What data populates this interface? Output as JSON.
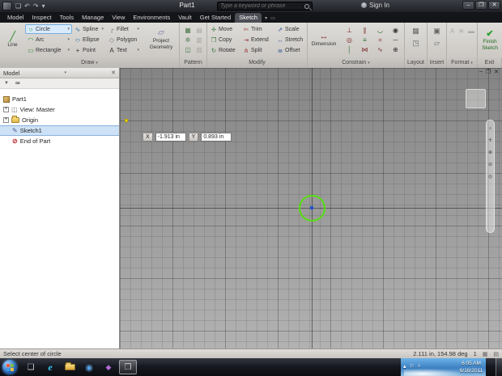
{
  "ui": {
    "dropdown": "▾"
  },
  "titlebar": {
    "qat_icons": [
      "❏",
      "↶",
      "↷",
      "▾"
    ],
    "title": "Part1",
    "search_placeholder": "Type a keyword or phrase",
    "sign_in": "Sign In",
    "minimize": "–",
    "maximize": "❐",
    "close": "✕"
  },
  "tabs": [
    {
      "label": "Model"
    },
    {
      "label": "Inspect"
    },
    {
      "label": "Tools"
    },
    {
      "label": "Manage"
    },
    {
      "label": "View"
    },
    {
      "label": "Environments"
    },
    {
      "label": "Vault"
    },
    {
      "label": "Get Started"
    },
    {
      "label": "Sketch"
    }
  ],
  "tab_extras": {
    "arrow": "▾",
    "panel_toggle": "▭"
  },
  "ribbon": {
    "draw": {
      "label": "Draw",
      "line": {
        "glyph": "╱",
        "label": "Line"
      },
      "tools": [
        {
          "glyph": "○",
          "label": "Circle"
        },
        {
          "glyph": "∿",
          "label": "Spline"
        },
        {
          "glyph": "╭",
          "label": "Fillet"
        },
        {
          "glyph": "◠",
          "label": "Arc"
        },
        {
          "glyph": "○",
          "label": "Ellipse"
        },
        {
          "glyph": "◇",
          "label": "Polygon"
        },
        {
          "glyph": "▭",
          "label": "Rectangle"
        },
        {
          "glyph": "+",
          "label": "Point"
        },
        {
          "glyph": "A",
          "label": "Text"
        }
      ],
      "project": {
        "glyph": "▱",
        "line1": "Project",
        "line2": "Geometry"
      }
    },
    "pattern": {
      "label": "Pattern",
      "glyphs": [
        "▦",
        "▤",
        "✲",
        "▥",
        "◫",
        "▧"
      ]
    },
    "modify": {
      "label": "Modify",
      "tools": [
        {
          "glyph": "✛",
          "label": "Move"
        },
        {
          "glyph": "✄",
          "label": "Trim"
        },
        {
          "glyph": "⇗",
          "label": "Scale"
        },
        {
          "glyph": "❐",
          "label": "Copy"
        },
        {
          "glyph": "⇥",
          "label": "Extend"
        },
        {
          "glyph": "↔",
          "label": "Stretch"
        },
        {
          "glyph": "↻",
          "label": "Rotate"
        },
        {
          "glyph": "⋔",
          "label": "Split"
        },
        {
          "glyph": "≣",
          "label": "Offset"
        }
      ]
    },
    "constrain": {
      "label": "Constrain",
      "dimension": {
        "glyph": "↔",
        "label": "Dimension"
      },
      "glyphs": [
        "⊥",
        "∥",
        "◡",
        "◉",
        "◎",
        "≡",
        "=",
        "─",
        "│",
        "⋈",
        "∿",
        "⊕"
      ]
    },
    "layout": {
      "label": "Layout",
      "glyphs": [
        "▦",
        "◳"
      ]
    },
    "insert": {
      "label": "Insert",
      "glyphs": [
        "▣",
        "▱"
      ]
    },
    "format": {
      "label": "Format",
      "glyphs": [
        "A",
        "≋",
        "▬"
      ]
    },
    "exit": {
      "label": "Exit",
      "check": "✔",
      "line1": "Finish",
      "line2": "Sketch"
    }
  },
  "browser": {
    "title": "Model",
    "close": "✕",
    "filter_glyph": "▼",
    "find_glyph": "∞",
    "plus": "+",
    "view_master_glyph": "◫",
    "sketch_glyph": "✎",
    "eop_glyph": "⊘",
    "tree": [
      {
        "label": "Part1"
      },
      {
        "label": "View: Master"
      },
      {
        "label": "Origin"
      },
      {
        "label": "Sketch1"
      },
      {
        "label": "End of Part"
      }
    ]
  },
  "canvas": {
    "x_label": "X",
    "x_value": "-1.913 in",
    "y_label": "Y",
    "y_value": "0.893 in",
    "circle_color": "#55e00e",
    "nav_glyphs": [
      "⌂",
      "✛",
      "⊕",
      "⊖",
      "◎"
    ],
    "doc_minimize": "–",
    "doc_restore": "❐",
    "doc_close": "✕"
  },
  "statusbar": {
    "prompt": "Select center of circle",
    "readout": "2.111 in, 154.98 deg",
    "counter": "1",
    "grid_icon": "▦",
    "grid_icon2": "▤"
  },
  "taskbar": {
    "generic_glyph": "❏",
    "ie_glyph": "e",
    "media_glyph": "◉",
    "app5_glyph": "◆",
    "active_glyph": "❒",
    "tray_glyphs": [
      "▴",
      "⚐",
      "♪"
    ],
    "clock_time": "6:05 AM",
    "clock_date": "6/16/2011"
  }
}
